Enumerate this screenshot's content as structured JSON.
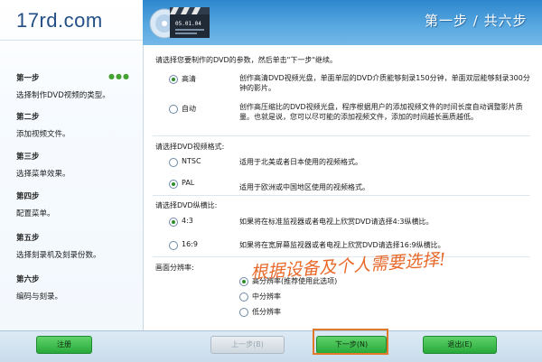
{
  "logo": "17rd.com",
  "header": {
    "title": "第一步 / 共六步",
    "disc_label": "05.01.04"
  },
  "steps": [
    {
      "title": "第一步",
      "desc": "选择制作DVD视频的类型。",
      "dots": "●●●"
    },
    {
      "title": "第二步",
      "desc": "添加视频文件。"
    },
    {
      "title": "第三步",
      "desc": "选择菜单效果。"
    },
    {
      "title": "第四步",
      "desc": "配置菜单。"
    },
    {
      "title": "第五步",
      "desc": "选择刻录机及刻录份数。"
    },
    {
      "title": "第六步",
      "desc": "编码与刻录。"
    }
  ],
  "main": {
    "intro": "请选择您要制作的DVD的参数，然后单击\"下一步\"继续。",
    "quality_options": [
      {
        "label": "高清",
        "desc": "创作高清DVD视频光盘，单面单层的DVD介质能够刻录150分钟，单面双层能够刻录300分钟的影片。",
        "checked": true
      },
      {
        "label": "自动",
        "desc": "创作高压缩比的DVD视频光盘，程序根据用户的添加视频文件的时间长度自动调整影片质量。也就是说，您可以尽可能的添加视频文件，添加的时间越长画质越低。",
        "checked": false
      }
    ],
    "format_title": "请选择DVD视频格式:",
    "format_options": [
      {
        "label": "NTSC",
        "desc": "适用于北美或者日本使用的视频格式。",
        "checked": false
      },
      {
        "label": "PAL",
        "desc": "适用于欧洲或中国地区使用的视频格式。",
        "checked": true
      }
    ],
    "aspect_title": "请选择DVD纵横比:",
    "aspect_options": [
      {
        "label": "4:3",
        "desc": "如果将在标准监视器或者电视上欣赏DVD请选择4:3纵横比。",
        "checked": true
      },
      {
        "label": "16:9",
        "desc": "如果将在宽屏幕监视器或者电视上欣赏DVD请选择16:9纵横比。",
        "checked": false
      }
    ],
    "resolution_title": "画面分辨率:",
    "resolution_options": [
      {
        "label": "高分辨率(推荐使用此选项)",
        "checked": true
      },
      {
        "label": "中分辨率",
        "checked": false
      },
      {
        "label": "低分辨率",
        "checked": false
      }
    ],
    "annotation": "根据设备及个人需要选择!"
  },
  "buttons": {
    "register": "注册",
    "prev": "上一步(B)",
    "next": "下一步(N)",
    "exit": "退出(E)"
  },
  "colors": {
    "header": "#3f96d8",
    "button_green": "#34b345",
    "annotation": "#e8692a"
  }
}
